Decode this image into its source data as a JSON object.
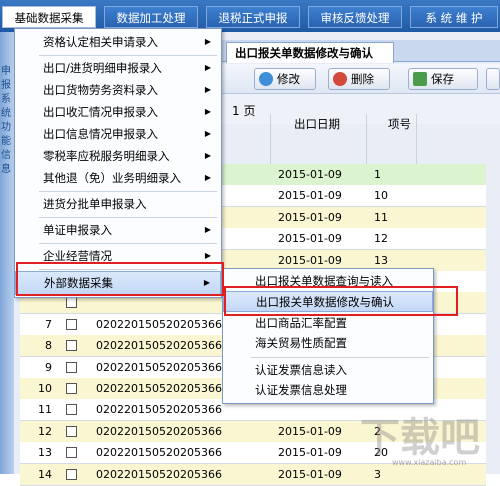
{
  "menubar": {
    "items": [
      "基础数据采集",
      "数据加工处理",
      "退税正式申报",
      "审核反馈处理",
      "系 统 维 护"
    ]
  },
  "leftstrip": {
    "chars": [
      "申",
      "报",
      "系",
      "统",
      "功",
      "能",
      "信",
      "息"
    ]
  },
  "tab": {
    "active_label": "出口报关单数据修改与确认"
  },
  "toolbar": {
    "modify": "修改",
    "delete": "删除",
    "save": "保存"
  },
  "pager": {
    "text": "1 页"
  },
  "grid": {
    "headers": {
      "date": "出口日期",
      "item": "项号"
    },
    "rows": [
      {
        "num": "",
        "id": "",
        "date": "2015-01-09",
        "item": "1",
        "bg": "g"
      },
      {
        "num": "",
        "id": "",
        "date": "2015-01-09",
        "item": "10",
        "bg": "w"
      },
      {
        "num": "",
        "id": "",
        "date": "2015-01-09",
        "item": "11",
        "bg": "y"
      },
      {
        "num": "",
        "id": "",
        "date": "2015-01-09",
        "item": "12",
        "bg": "w"
      },
      {
        "num": "",
        "id": "",
        "date": "2015-01-09",
        "item": "13",
        "bg": "y"
      },
      {
        "num": "",
        "id": "",
        "date": "",
        "item": "",
        "bg": "w"
      },
      {
        "num": "",
        "id": "",
        "date": "",
        "item": "",
        "bg": "y"
      },
      {
        "num": "7",
        "id": "020220150520205366",
        "date": "",
        "item": "",
        "bg": "w"
      },
      {
        "num": "8",
        "id": "020220150520205366",
        "date": "",
        "item": "",
        "bg": "y"
      },
      {
        "num": "9",
        "id": "020220150520205366",
        "date": "",
        "item": "",
        "bg": "w"
      },
      {
        "num": "10",
        "id": "020220150520205366",
        "date": "",
        "item": "",
        "bg": "y"
      },
      {
        "num": "11",
        "id": "020220150520205366",
        "date": "",
        "item": "",
        "bg": "w"
      },
      {
        "num": "12",
        "id": "020220150520205366",
        "date": "2015-01-09",
        "item": "2",
        "bg": "y"
      },
      {
        "num": "13",
        "id": "020220150520205366",
        "date": "2015-01-09",
        "item": "20",
        "bg": "w"
      },
      {
        "num": "14",
        "id": "020220150520205366",
        "date": "2015-01-09",
        "item": "3",
        "bg": "y"
      }
    ]
  },
  "dropdown": {
    "items": [
      {
        "label": "资格认定相关申请录入",
        "arrow": true
      },
      {
        "label": "出口/进货明细申报录入",
        "arrow": true
      },
      {
        "label": "出口货物劳务资料录入",
        "arrow": true
      },
      {
        "label": "出口收汇情况申报录入",
        "arrow": true
      },
      {
        "label": "出口信息情况申报录入",
        "arrow": true
      },
      {
        "label": "零税率应税服务明细录入",
        "arrow": true
      },
      {
        "label": "其他退（免）业务明细录入",
        "arrow": true
      },
      {
        "label": "进货分批单申报录入",
        "arrow": false
      },
      {
        "label": "单证申报录入",
        "arrow": true
      },
      {
        "label": "企业经营情况",
        "arrow": true
      },
      {
        "label": "外部数据采集",
        "arrow": true
      }
    ]
  },
  "submenu": {
    "items": [
      "出口报关单数据查询与读入",
      "出口报关单数据修改与确认",
      "出口商品汇率配置",
      "海关贸易性质配置",
      "认证发票信息读入",
      "认证发票信息处理"
    ]
  },
  "watermark": {
    "text": "下载吧",
    "sub": "www.xiazaiba.com"
  },
  "colors": {
    "menubar": "#2a63b1",
    "highlight": "#c3d8f6",
    "redbox": "#e02020",
    "row_yellow": "#fbf6d2",
    "row_green": "#dcf3d0"
  }
}
